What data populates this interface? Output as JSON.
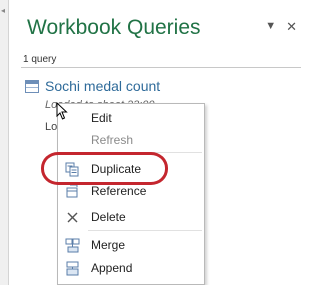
{
  "pane": {
    "title": "Workbook Queries",
    "query_count": "1 query",
    "accent_color": "#217346"
  },
  "query": {
    "name": "Sochi medal count",
    "subtitle_line1": "Loaded to sheet 23:00",
    "subtitle_line2": "Lo",
    "icon": "table-icon"
  },
  "context_menu": {
    "items": [
      {
        "label": "Edit",
        "icon": "",
        "enabled": true
      },
      {
        "label": "Refresh",
        "icon": "",
        "enabled": false
      },
      {
        "label": "Duplicate",
        "icon": "duplicate-icon",
        "enabled": true
      },
      {
        "label": "Reference",
        "icon": "reference-icon",
        "enabled": true
      },
      {
        "label": "Delete",
        "icon": "delete-icon",
        "enabled": true
      },
      {
        "label": "Merge",
        "icon": "merge-icon",
        "enabled": true
      },
      {
        "label": "Append",
        "icon": "append-icon",
        "enabled": true
      }
    ]
  },
  "annotation": {
    "highlight_color": "#c4262e",
    "highlighted_item": "Duplicate"
  }
}
